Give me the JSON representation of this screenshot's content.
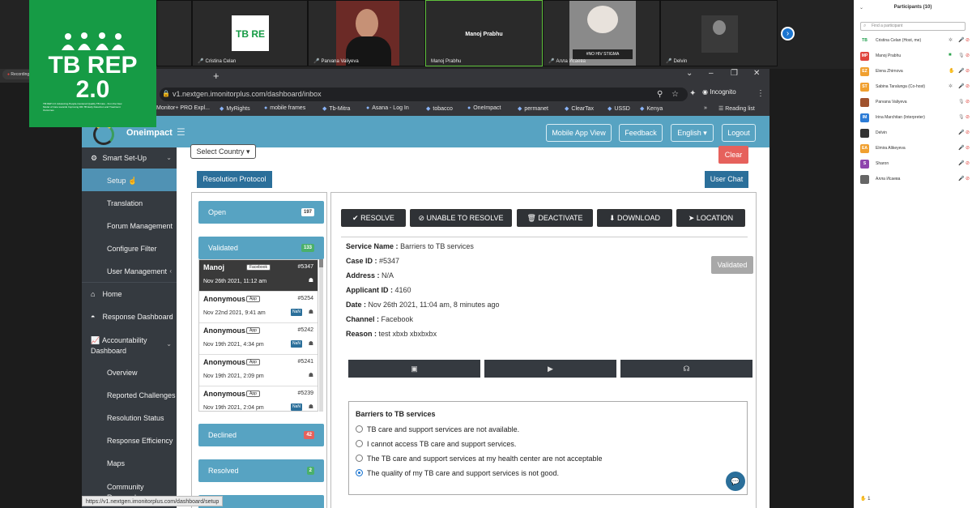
{
  "video": {
    "tiles": [
      {
        "name": "",
        "label": ""
      },
      {
        "name": "Cristina Celan",
        "label": "TB RE"
      },
      {
        "name": "Parvana Valiyeva",
        "label": ""
      },
      {
        "name": "Manoj Prabhu",
        "label": "Manoj Prabhu"
      },
      {
        "name": "Алла Исаева",
        "label": "#NO HIV STIGMA"
      },
      {
        "name": "Delvin",
        "label": ""
      }
    ]
  },
  "overlay_logo": {
    "line1": "TB REP",
    "line2": "2.0",
    "tagline": "TB REP 2.0: Advancing People-Centered Quality TB Care - from the New Model of Care towards Improving DR-TB Early Detection and Treatment Outcomes"
  },
  "recording": {
    "label": "Recording"
  },
  "browser": {
    "url": "v1.nextgen.imonitorplus.com/dashboard/inbox",
    "profile": "Incognito",
    "new_tab": "+",
    "bookmarks": [
      "Monitor+ PRO Expl...",
      "MyRights",
      "mobile frames",
      "Tb-Mitra",
      "Asana - Log In",
      "tobacco",
      "OneImpact",
      "permanet",
      "ClearTax",
      "USSD",
      "Kenya"
    ],
    "more": "»",
    "reading_list": "Reading list",
    "status_url": "https://v1.nextgen.imonitorplus.com/dashboard/setup"
  },
  "app": {
    "brand": "Oneimpact",
    "header_buttons": {
      "mobile": "Mobile App View",
      "feedback": "Feedback",
      "language": "English ▾",
      "logout": "Logout"
    },
    "sidebar": {
      "smart_setup": "Smart Set-Up",
      "setup": "Setup",
      "translation": "Translation",
      "forum": "Forum Management",
      "filter": "Configure Filter",
      "users": "User Management",
      "home": "Home",
      "response": "Response Dashboard",
      "accountability": "Accountability Dashboard",
      "overview": "Overview",
      "challenges": "Reported Challenges",
      "resolution_status": "Resolution Status",
      "efficiency": "Response Efficiency",
      "maps": "Maps",
      "community": "Community Responders"
    },
    "select_country": "Select Country ▾",
    "clear": "Clear",
    "resolution_protocol": "Resolution Protocol",
    "user_chat": "User Chat",
    "statuses": {
      "open": {
        "label": "Open",
        "count": "197"
      },
      "validated": {
        "label": "Validated",
        "count": "133"
      },
      "declined": {
        "label": "Declined",
        "count": "42"
      },
      "resolved": {
        "label": "Resolved",
        "count": "2"
      }
    },
    "cases": [
      {
        "name": "Manoj",
        "source": "Facebook",
        "id": "#5347",
        "date": "Nov 26th 2021, 11:12 am",
        "nan": ""
      },
      {
        "name": "Anonymous",
        "source": "App",
        "id": "#5254",
        "date": "Nov 22nd 2021, 9:41 am",
        "nan": "NaN"
      },
      {
        "name": "Anonymous",
        "source": "App",
        "id": "#5242",
        "date": "Nov 19th 2021, 4:34 pm",
        "nan": "NaN"
      },
      {
        "name": "Anonymous",
        "source": "App",
        "id": "#5241",
        "date": "Nov 19th 2021, 2:09 pm",
        "nan": ""
      },
      {
        "name": "Anonymous",
        "source": "App",
        "id": "#5239",
        "date": "Nov 19th 2021, 2:04 pm",
        "nan": "NaN"
      }
    ],
    "actions": {
      "resolve": "✔ RESOLVE",
      "unable": "⊘ UNABLE TO RESOLVE",
      "deactivate": "🗑 DEACTIVATE",
      "download": "⬇ DOWNLOAD",
      "location": "➤ LOCATION"
    },
    "detail": {
      "service_label": "Service Name :",
      "service": "Barriers to TB services",
      "case_label": "Case ID :",
      "case": "#5347",
      "address_label": "Address :",
      "address": "N/A",
      "applicant_label": "Applicant ID :",
      "applicant": "4160",
      "date_label": "Date :",
      "date": "Nov 26th 2021, 11:04 am, 8 minutes ago",
      "channel_label": "Channel :",
      "channel": "Facebook",
      "reason_label": "Reason :",
      "reason": "test xbxb xbxbxbx",
      "status": "Validated"
    },
    "barriers": {
      "title": "Barriers to TB services",
      "options": [
        "TB care and support services are not available.",
        "I cannot access TB care and support services.",
        "The TB care and support services at my health center are not acceptable",
        "The quality of my TB care and support services is not good."
      ],
      "selected": 3
    }
  },
  "participants": {
    "title": "Participants (10)",
    "search_placeholder": "Find a participant",
    "list": [
      {
        "initials": "",
        "name": "Cristina Celan (Host, me)",
        "color": "#ffffff"
      },
      {
        "initials": "MP",
        "name": "Manoj Prabhu",
        "color": "#e0453d"
      },
      {
        "initials": "EZ",
        "name": "Elena Zhirnova",
        "color": "#f0a030"
      },
      {
        "initials": "ST",
        "name": "Sabina Taralunga (Co-host)",
        "color": "#f0a030"
      },
      {
        "initials": "",
        "name": "Parvana Valiyeva",
        "color": "#a0522d"
      },
      {
        "initials": "IM",
        "name": "Irina Marchitan (Interpreter)",
        "color": "#2d7cd6"
      },
      {
        "initials": "",
        "name": "Delvin",
        "color": "#333333"
      },
      {
        "initials": "EA",
        "name": "Elmira Alikeyeva",
        "color": "#f0a030"
      },
      {
        "initials": "S",
        "name": "Sharon",
        "color": "#8e44ad"
      },
      {
        "initials": "",
        "name": "Алла Исаева",
        "color": "#666666"
      }
    ],
    "footer_count": "1"
  }
}
